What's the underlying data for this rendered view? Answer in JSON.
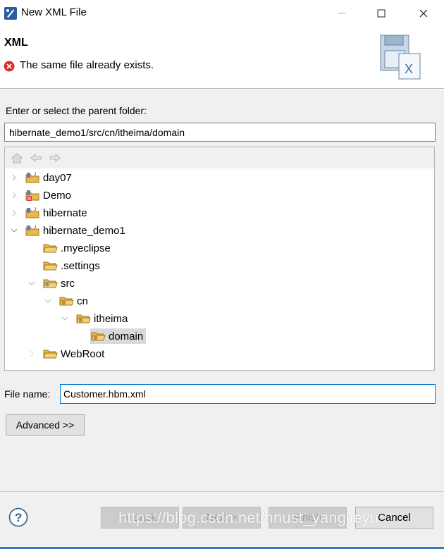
{
  "window": {
    "title": "New XML File"
  },
  "banner": {
    "title": "XML",
    "message": "The same file already exists."
  },
  "parent_folder": {
    "label": "Enter or select the parent folder:",
    "value": "hibernate_demo1/src/cn/itheima/domain"
  },
  "tree": {
    "items": [
      {
        "label": "day07",
        "icon": "java-project-icon",
        "expanded": false,
        "selected": false
      },
      {
        "label": "Demo",
        "icon": "java-project-error-icon",
        "expanded": false,
        "selected": false
      },
      {
        "label": "hibernate",
        "icon": "java-project-icon",
        "expanded": false,
        "selected": false
      },
      {
        "label": "hibernate_demo1",
        "icon": "java-project-icon",
        "expanded": true,
        "selected": false
      },
      {
        "label": ".myeclipse",
        "icon": "folder-icon",
        "expanded": false,
        "selected": false
      },
      {
        "label": ".settings",
        "icon": "folder-icon",
        "expanded": false,
        "selected": false
      },
      {
        "label": "src",
        "icon": "source-folder-icon",
        "expanded": true,
        "selected": false
      },
      {
        "label": "cn",
        "icon": "package-folder-icon",
        "expanded": true,
        "selected": false
      },
      {
        "label": "itheima",
        "icon": "package-folder-icon",
        "expanded": true,
        "selected": false
      },
      {
        "label": "domain",
        "icon": "package-folder-icon",
        "expanded": false,
        "selected": true
      },
      {
        "label": "WebRoot",
        "icon": "folder-icon",
        "expanded": false,
        "selected": false
      }
    ]
  },
  "file_name": {
    "label": "File name:",
    "value": "Customer.hbm.xml"
  },
  "buttons": {
    "advanced": "Advanced >>",
    "back": "< Back",
    "next": "Next >",
    "finish": "Finish",
    "cancel": "Cancel"
  },
  "watermark": "https://blog.csdn.net/hnust_yangjieyu",
  "colors": {
    "error": "#d9302b",
    "folder": "#e8b84a",
    "focus": "#0078d7",
    "selection": "#d9d9d9"
  }
}
